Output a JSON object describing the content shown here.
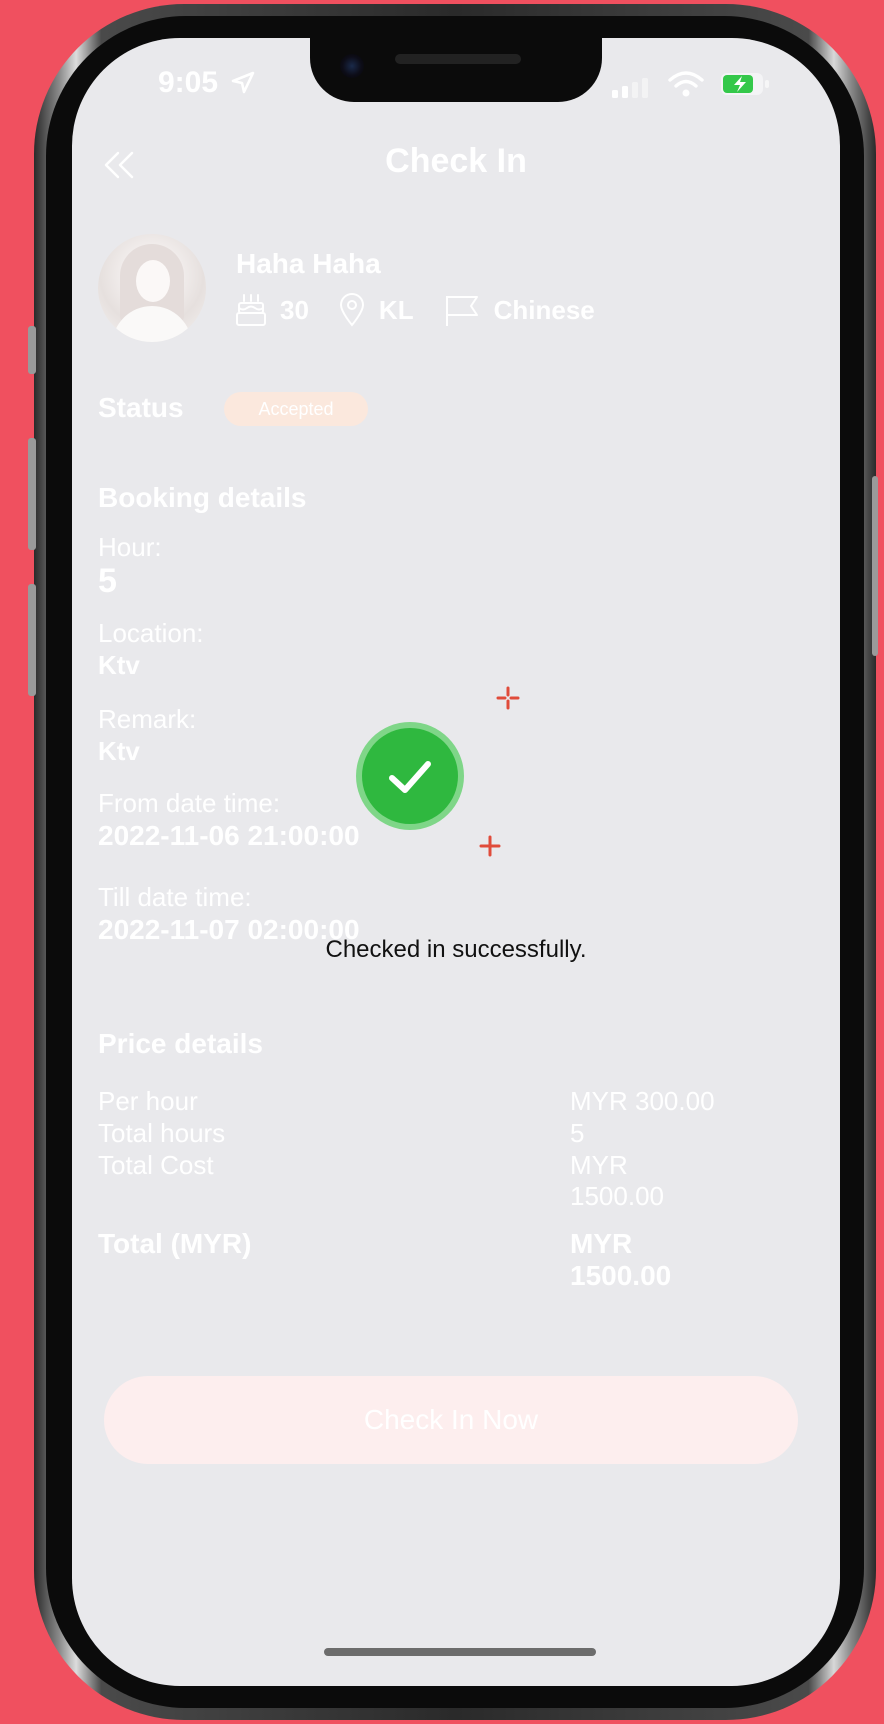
{
  "status_bar": {
    "time": "9:05"
  },
  "header": {
    "title": "Check In",
    "back_icon": "double-chevron-left-icon"
  },
  "profile": {
    "name": "Haha Haha",
    "age": "30",
    "location": "KL",
    "language": "Chinese"
  },
  "status": {
    "label": "Status",
    "badge": "Accepted"
  },
  "booking": {
    "heading": "Booking details",
    "hour_label": "Hour:",
    "hour_value": "5",
    "location_label": "Location:",
    "location_value": "Ktv",
    "remark_label": "Remark:",
    "remark_value": "Ktv",
    "from_label": "From date time:",
    "from_value": "2022-11-06 21:00:00",
    "till_label": "Till date time:",
    "till_value": "2022-11-07 02:00:00"
  },
  "toast": {
    "message": "Checked in successfully."
  },
  "price": {
    "heading": "Price details",
    "rows": [
      {
        "label": "Per hour",
        "value": "MYR 300.00"
      },
      {
        "label": "Total hours",
        "value": "5"
      },
      {
        "label": "Total Cost",
        "value": "MYR 1500.00"
      }
    ],
    "total_label": "Total (MYR)",
    "total_value": "MYR 1500.00"
  },
  "cta": {
    "label": "Check In Now"
  },
  "colors": {
    "background": "#f0505f",
    "screen": "#e9e9ec",
    "success": "#2fb83f",
    "badge": "#fbe8dd",
    "sparkle": "#e04b3a"
  }
}
